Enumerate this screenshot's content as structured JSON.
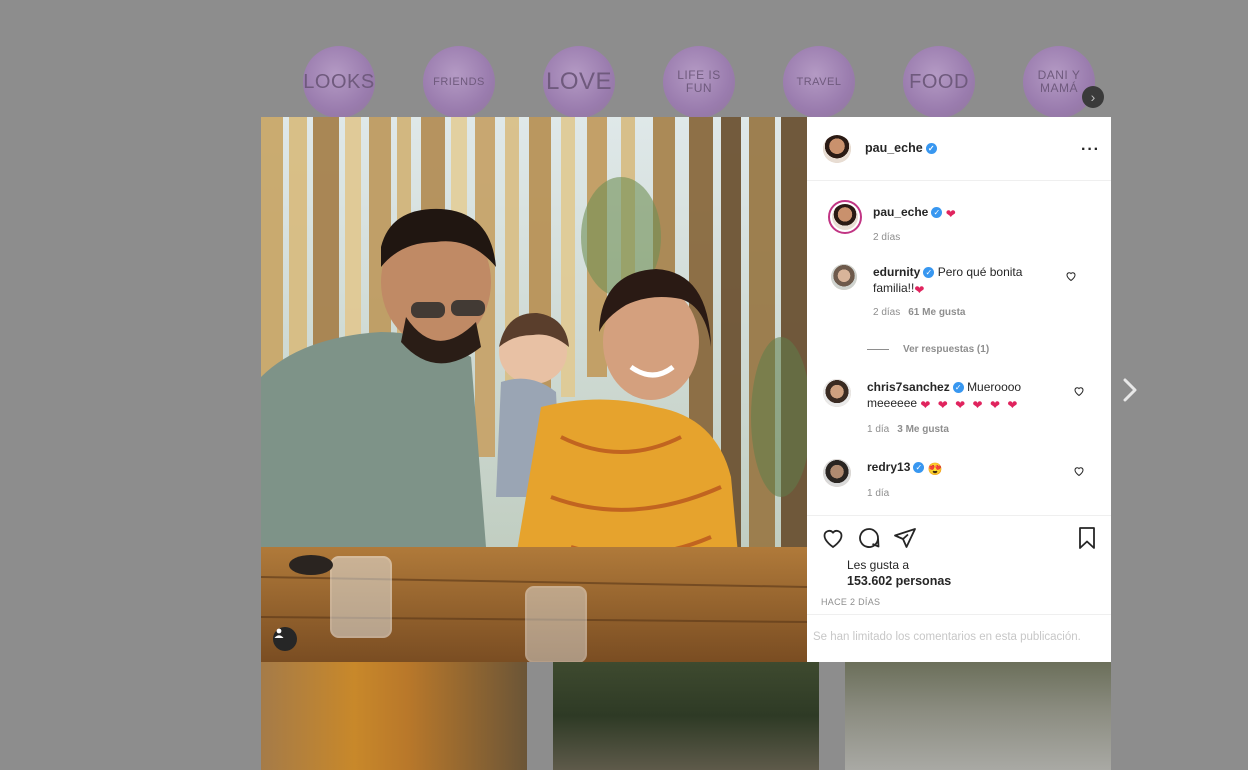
{
  "highlights": [
    {
      "label": "LOOKS"
    },
    {
      "label": "FRIENDS"
    },
    {
      "label": "LOVE"
    },
    {
      "label": "LIFE IS FUN"
    },
    {
      "label": "TRAVEL"
    },
    {
      "label": "FOOD"
    },
    {
      "label": "DANI Y MAMÁ"
    }
  ],
  "post": {
    "author": {
      "username": "pau_eche",
      "verified": true
    },
    "caption": {
      "username": "pau_eche",
      "emoji": "❤",
      "time": "2 días"
    },
    "comments": [
      {
        "username": "edurnity",
        "verified": true,
        "text": "Pero qué bonita familia!!",
        "emoji": "❤",
        "time": "2 días",
        "likes": "61 Me gusta"
      },
      {
        "username": "chris7sanchez",
        "verified": true,
        "text": "Mueroooo meeeeee",
        "emoji": "❤ ❤ ❤ ❤ ❤ ❤",
        "time": "1 día",
        "likes": "3 Me gusta"
      },
      {
        "username": "redry13",
        "verified": true,
        "text": "",
        "emoji": "😍",
        "time": "1 día",
        "likes": ""
      }
    ],
    "view_replies": "Ver respuestas (1)",
    "likes_prefix": "Les gusta a",
    "likes_count": "153.602 personas",
    "date": "HACE 2 DÍAS",
    "comments_limited": "Se han limitado los comentarios en esta publicación."
  },
  "icons": {
    "like": "heart-icon",
    "comment": "comment-icon",
    "share": "share-icon",
    "save": "bookmark-icon",
    "more": "more-options-icon",
    "next": "chevron-right-icon",
    "user_tags": "user-tag-icon"
  },
  "colors": {
    "verified": "#3897f0",
    "heart_emoji": "#e0245e",
    "muted_text": "#8e8e8e",
    "story_ring": "#c13584"
  }
}
